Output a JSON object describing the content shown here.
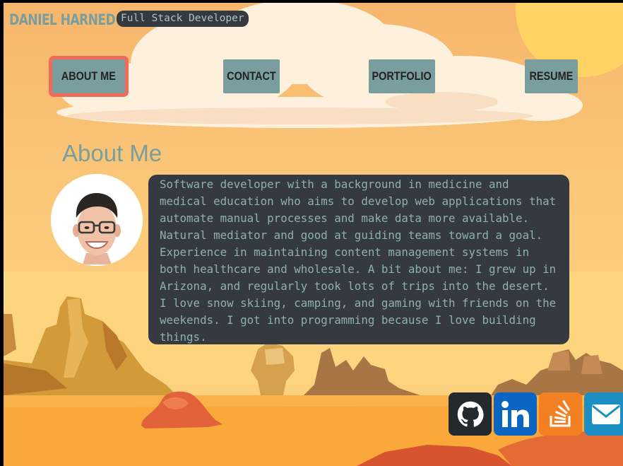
{
  "header": {
    "name": "DANIEL HARNED",
    "subtitle": "Full Stack Developer"
  },
  "nav": {
    "items": [
      {
        "label": "ABOUT ME",
        "active": true
      },
      {
        "label": "CONTACT",
        "active": false
      },
      {
        "label": "PORTFOLIO",
        "active": false
      },
      {
        "label": "RESUME",
        "active": false
      }
    ]
  },
  "about": {
    "title": "About Me",
    "bio": "Software developer with a background in medicine and medical education who aims to develop web applications that automate manual processes and make data more available. Natural mediator and good at guiding teams toward a goal. Experience in maintaining content management systems in both healthcare and wholesale. A bit about me: I grew up in Arizona, and regularly took lots of trips into the desert. I love snow skiing, camping, and gaming with friends on the weekends. I got into programming because I love building things."
  },
  "social": [
    {
      "name": "github",
      "icon": "github-icon",
      "color": "#24292e"
    },
    {
      "name": "linkedin",
      "icon": "linkedin-icon",
      "color": "#0a66c2"
    },
    {
      "name": "stackoverflow",
      "icon": "stackoverflow-icon",
      "color": "#f48024"
    },
    {
      "name": "email",
      "icon": "envelope-icon",
      "color": "#1b8fc4"
    }
  ],
  "colors": {
    "accent": "#7a9e9e",
    "active_outline": "#f06a5a",
    "panel": "#343a40",
    "sky": "#f7b866",
    "sand": "#fba83a"
  }
}
